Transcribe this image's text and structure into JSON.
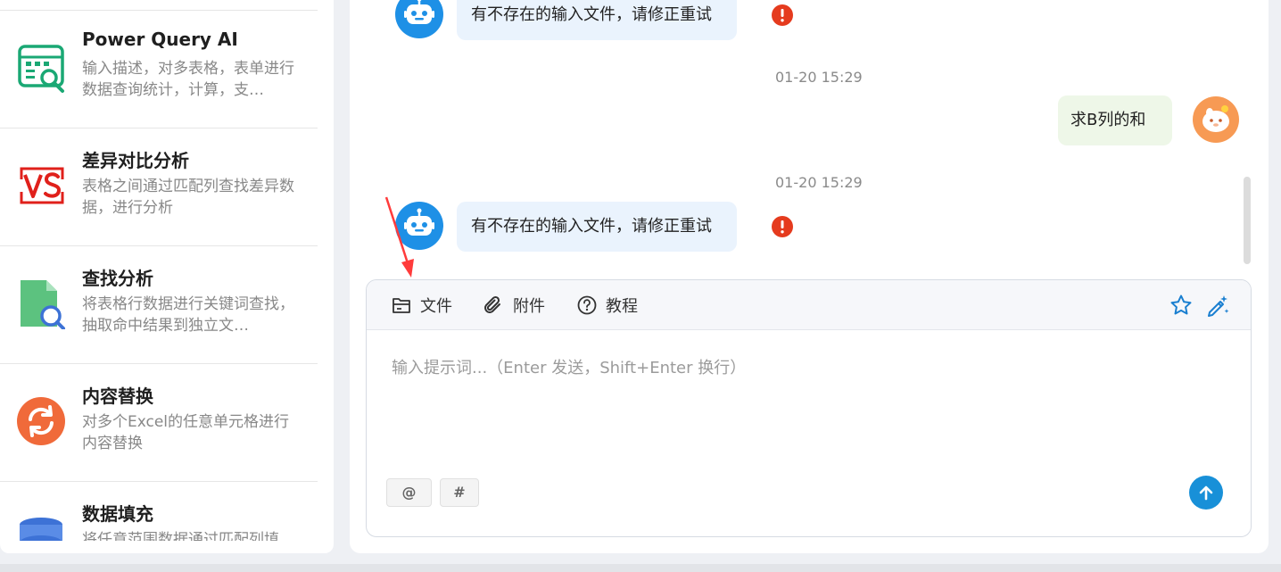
{
  "sidebar": {
    "cards": [
      {
        "title": "Power Query AI",
        "desc": "输入描述，对多表格，表单进行数据查询统计，计算，支…",
        "icon": "table-search-icon",
        "color": "#1aa874"
      },
      {
        "title": "差异对比分析",
        "desc": "表格之间通过匹配列查找差异数据，进行分析",
        "icon": "vs-icon",
        "color": "#e0201b"
      },
      {
        "title": "查找分析",
        "desc": "将表格行数据进行关键词查找，抽取命中结果到独立文…",
        "icon": "file-search-icon",
        "color": "#4fc27a"
      },
      {
        "title": "内容替换",
        "desc": "对多个Excel的任意单元格进行内容替换",
        "icon": "refresh-icon",
        "color": "#f06a3a"
      },
      {
        "title": "数据填充",
        "desc": "将任意范围数据通过匹配列填",
        "icon": "database-icon",
        "color": "#3d72d6"
      }
    ]
  },
  "chat": {
    "messages": [
      {
        "role": "bot",
        "text": "有不存在的输入文件，请修正重试",
        "status": "error"
      },
      {
        "timestamp": "01-20 15:29"
      },
      {
        "role": "user",
        "text": "求B列的和"
      },
      {
        "timestamp": "01-20 15:29"
      },
      {
        "role": "bot",
        "text": "有不存在的输入文件，请修正重试",
        "status": "error"
      }
    ]
  },
  "composer": {
    "toolbar": {
      "file_label": "文件",
      "attach_label": "附件",
      "tutorial_label": "教程"
    },
    "placeholder": "输入提示词...（Enter 发送，Shift+Enter 换行）",
    "value": "",
    "chip_at": "@",
    "chip_hash": "#"
  },
  "colors": {
    "accent": "#1890d8",
    "bot_bubble": "#eaf3fd",
    "user_bubble": "#eef7e8",
    "error": "#e53b1e"
  }
}
